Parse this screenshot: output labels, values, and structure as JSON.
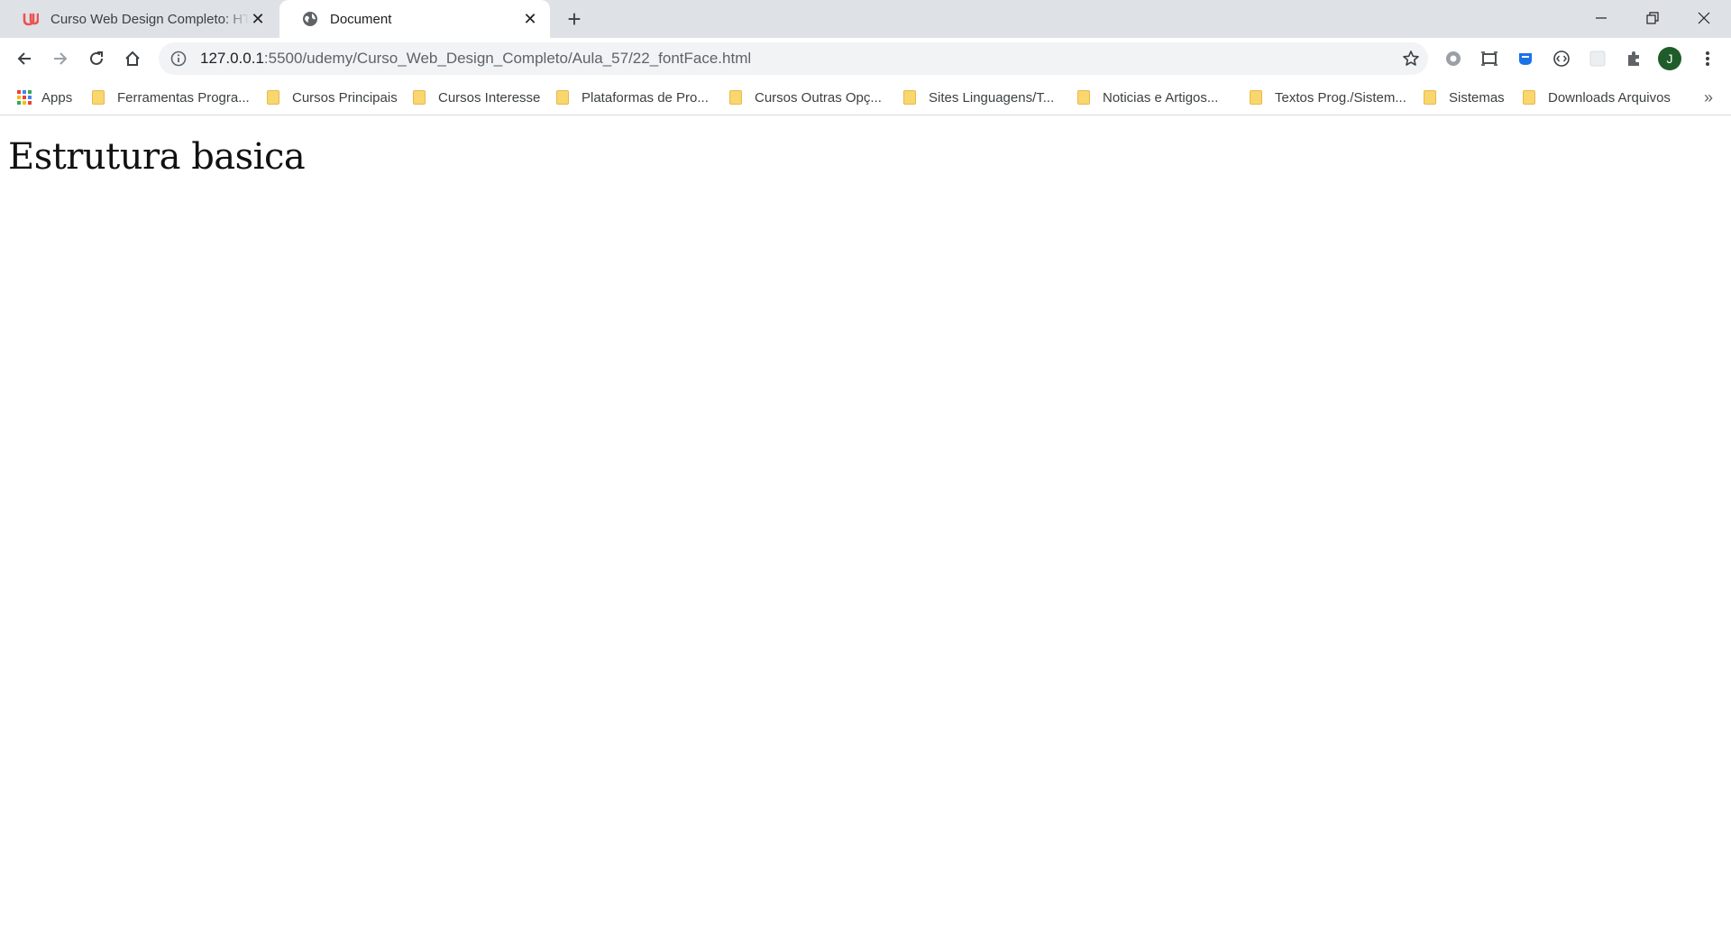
{
  "browser": {
    "tabs": [
      {
        "title": "Curso Web Design Completo: HTML",
        "favicon": "udemy-icon",
        "active": false
      },
      {
        "title": "Document",
        "favicon": "globe-icon",
        "active": true
      }
    ],
    "address": {
      "host": "127.0.0.1",
      "path": ":5500/udemy/Curso_Web_Design_Completo/Aula_57/22_fontFace.html"
    },
    "profile_initial": "J",
    "colors": {
      "tabstrip": "#dee1e6",
      "omnibox": "#f1f3f4",
      "avatar": "#1e5d2a",
      "folder": "#f9d66e",
      "udemy": "#ec5252"
    }
  },
  "bookmarks": {
    "apps_label": "Apps",
    "items": [
      "Ferramentas Progra...",
      "Cursos Principais",
      "Cursos Interesse",
      "Plataformas de Pro...",
      "Cursos Outras Opç...",
      "Sites Linguagens/T...",
      "Noticias e Artigos...",
      "Textos Prog./Sistem...",
      "Sistemas",
      "Downloads Arquivos"
    ],
    "more": "»"
  },
  "page": {
    "heading": "Estrutura basica"
  }
}
